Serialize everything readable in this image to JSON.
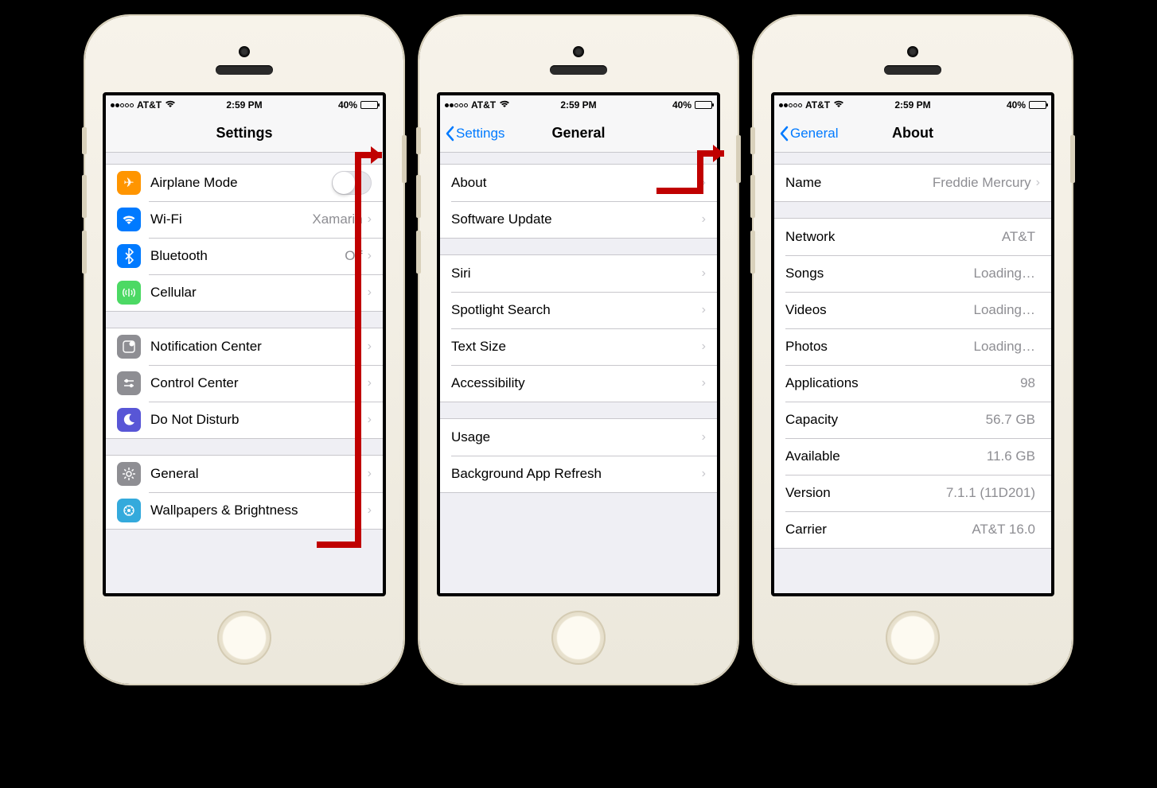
{
  "statusbar": {
    "carrier": "AT&T",
    "time": "2:59 PM",
    "battery": "40%"
  },
  "screen1": {
    "title": "Settings",
    "rows": {
      "airplane": "Airplane Mode",
      "wifi": "Wi-Fi",
      "wifi_value": "Xamarin",
      "bt": "Bluetooth",
      "bt_value": "Off",
      "cell": "Cellular",
      "notif": "Notification Center",
      "cc": "Control Center",
      "dnd": "Do Not Disturb",
      "general": "General",
      "wall": "Wallpapers & Brightness"
    }
  },
  "screen2": {
    "back": "Settings",
    "title": "General",
    "rows": {
      "about": "About",
      "su": "Software Update",
      "siri": "Siri",
      "spot": "Spotlight Search",
      "text": "Text Size",
      "acc": "Accessibility",
      "usage": "Usage",
      "bgapp": "Background App Refresh"
    }
  },
  "screen3": {
    "back": "General",
    "title": "About",
    "rows": {
      "name": "Name",
      "name_value": "Freddie Mercury",
      "network": "Network",
      "network_value": "AT&T",
      "songs": "Songs",
      "songs_value": "Loading…",
      "videos": "Videos",
      "videos_value": "Loading…",
      "photos": "Photos",
      "photos_value": "Loading…",
      "apps": "Applications",
      "apps_value": "98",
      "capacity": "Capacity",
      "capacity_value": "56.7 GB",
      "avail": "Available",
      "avail_value": "11.6 GB",
      "version": "Version",
      "version_value": "7.1.1 (11D201)",
      "carrier": "Carrier",
      "carrier_value": "AT&T 16.0"
    }
  }
}
